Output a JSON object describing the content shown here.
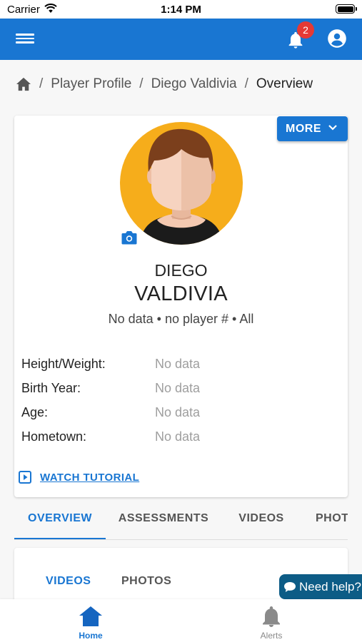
{
  "status_bar": {
    "carrier": "Carrier",
    "time": "1:14 PM"
  },
  "app_bar": {
    "notification_count": "2"
  },
  "breadcrumb": {
    "items": [
      "Player Profile",
      "Diego Valdivia"
    ],
    "current": "Overview"
  },
  "profile": {
    "more_label": "MORE",
    "first_name": "DIEGO",
    "last_name": "VALDIVIA",
    "meta": "No data • no player # • All",
    "details": [
      {
        "label": "Height/Weight:",
        "value": "No data"
      },
      {
        "label": "Birth Year:",
        "value": "No data"
      },
      {
        "label": "Age:",
        "value": "No data"
      },
      {
        "label": "Hometown:",
        "value": "No data"
      }
    ],
    "tutorial_label": "WATCH TUTORIAL"
  },
  "tabs": [
    "OVERVIEW",
    "ASSESSMENTS",
    "VIDEOS",
    "PHOT"
  ],
  "active_tab": "OVERVIEW",
  "subtabs": [
    "VIDEOS",
    "PHOTOS"
  ],
  "help_label": "Need help?",
  "bottom_nav": [
    {
      "label": "Home",
      "icon": "home-icon",
      "active": true
    },
    {
      "label": "Alerts",
      "icon": "bell-icon",
      "active": false
    }
  ],
  "colors": {
    "primary": "#1976d2",
    "badge": "#e53935",
    "help": "#0d5c86",
    "avatar_bg": "#f6ad1b"
  }
}
